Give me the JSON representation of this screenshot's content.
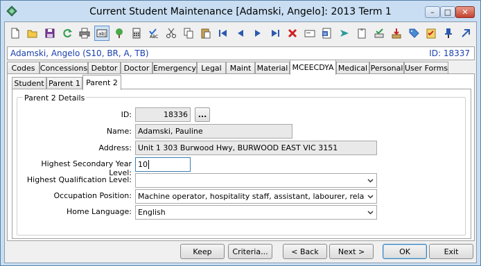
{
  "window": {
    "title": "Current Student Maintenance  [Adamski, Angelo]:  2013 Term 1",
    "controls": {
      "minimize": "–",
      "maximize": "□",
      "close": "✕"
    }
  },
  "toolbar": {
    "icons": [
      "new-icon",
      "open-icon",
      "save-icon",
      "refresh-icon",
      "print-icon",
      "field-label-icon",
      "tree-icon",
      "calculator-icon",
      "spellcheck-icon",
      "cut-icon",
      "copy-icon",
      "paste-icon",
      "first-record-icon",
      "previous-record-icon",
      "next-record-icon",
      "last-record-icon",
      "delete-icon",
      "card-icon",
      "word-icon",
      "send-icon",
      "clipboard-icon",
      "approve-icon",
      "download-icon",
      "tag-icon",
      "checklist-icon",
      "pin-icon",
      "arrow-up-right-icon"
    ]
  },
  "student_bar": {
    "name": "Adamski, Angelo (S10, BR, A, TB)",
    "id": "ID: 18337"
  },
  "main_tabs": [
    {
      "label": "Codes"
    },
    {
      "label": "Concessions"
    },
    {
      "label": "Debtor"
    },
    {
      "label": "Doctor"
    },
    {
      "label": "Emergency"
    },
    {
      "label": "Legal"
    },
    {
      "label": "Maint"
    },
    {
      "label": "Material"
    },
    {
      "label": "MCEECDYA",
      "selected": true
    },
    {
      "label": "Medical"
    },
    {
      "label": "Personal"
    },
    {
      "label": "User Forms"
    }
  ],
  "sub_tabs": [
    {
      "label": "Student"
    },
    {
      "label": "Parent 1"
    },
    {
      "label": "Parent 2",
      "selected": true
    }
  ],
  "group": {
    "title": "Parent 2 Details",
    "id_label": "ID:",
    "id_value": "18336",
    "lookup_label": "...",
    "name_label": "Name:",
    "name_value": "Adamski, Pauline",
    "address_label": "Address:",
    "address_value": "Unit 1 303 Burwood Hwy, BURWOOD EAST VIC 3151",
    "secondary_label": "Highest Secondary Year Level:",
    "secondary_value": "10",
    "qualification_label": "Highest Qualification Level:",
    "qualification_value": "",
    "occupation_label": "Occupation Position:",
    "occupation_value": "Machine operator, hospitality staff, assistant, labourer, related work",
    "language_label": "Home Language:",
    "language_value": "English"
  },
  "buttons": {
    "keep": "Keep",
    "criteria": "Criteria...",
    "back": "< Back",
    "next": "Next >",
    "ok": "OK",
    "exit": "Exit"
  },
  "colors": {
    "title_bar": "#c9def2",
    "student_text": "#1a3fae",
    "close_button": "#c4412e"
  }
}
